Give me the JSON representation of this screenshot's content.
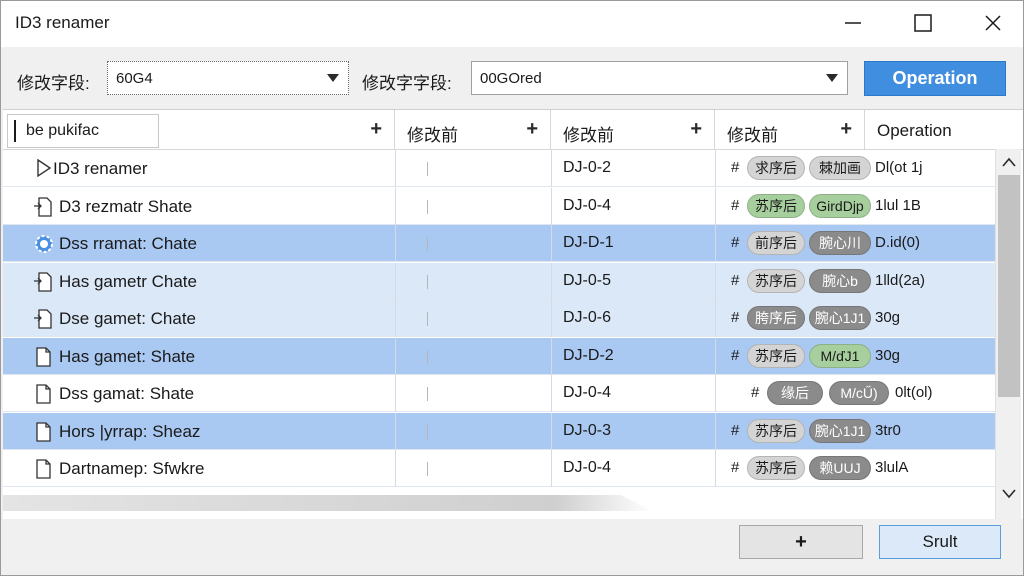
{
  "window": {
    "title": "ID3 renamer"
  },
  "toolbar": {
    "field1_label": "修改字段:",
    "field1_value": "60G4",
    "field2_label": "修改字字段:",
    "field2_value": "00GOred",
    "operation_label": "Operation"
  },
  "table": {
    "columns": [
      {
        "label": "be pukifac"
      },
      {
        "label": "修改前"
      },
      {
        "label": "修改前"
      },
      {
        "label": "修改前"
      },
      {
        "label": "Operation"
      }
    ],
    "rows": [
      {
        "name": "ID3 renamer",
        "code": "DJ-0-2",
        "tag1": "求序后",
        "tag2": "棘加画",
        "value": "Dl(ot 1j",
        "icon": "play-icon",
        "style": "plain",
        "tag1_color": "grey",
        "tag2_color": "grey"
      },
      {
        "name": "D3 rezmatr Shate",
        "code": "DJ-0-4",
        "tag1": "苏序后",
        "tag2": "GirdDjp",
        "value": "1lul 1B",
        "icon": "file-link-icon",
        "style": "plain",
        "tag1_color": "green",
        "tag2_color": "green"
      },
      {
        "name": "Dss rramat: Chate",
        "code": "DJ-D-1",
        "tag1": "前序后",
        "tag2": "腕心川",
        "value": "D.id(0)",
        "icon": "gear-icon",
        "style": "sel-strong",
        "tag1_color": "grey",
        "tag2_color": "dark"
      },
      {
        "name": "Has gametr Chate",
        "code": "DJ-0-5",
        "tag1": "苏序后",
        "tag2": "腕心b",
        "value": "1lld(2a)",
        "icon": "file-link-icon",
        "style": "sel-light",
        "tag1_color": "grey",
        "tag2_color": "dark"
      },
      {
        "name": "Dse gamet: Chate",
        "code": "DJ-0-6",
        "tag1": "胯序后",
        "tag2": "腕心1J1",
        "value": "30g",
        "icon": "file-link-icon",
        "style": "sel-light",
        "tag1_color": "dark",
        "tag2_color": "dark"
      },
      {
        "name": "Has gamet: Shate",
        "code": "DJ-D-2",
        "tag1": "苏序后",
        "tag2": "M/ďJ1",
        "value": "30g",
        "icon": "file-icon",
        "style": "sel-strong",
        "tag1_color": "grey",
        "tag2_color": "green"
      },
      {
        "name": "Dss gamat: Shate",
        "code": "DJ-0-4",
        "tag1": "缘后",
        "tag2": "M/cŰ)",
        "value": "0lt(ol)",
        "icon": "file-icon",
        "style": "plain",
        "tag1_color": "dark",
        "tag2_color": "dark"
      },
      {
        "name": "Hors |yrrap: Sheaz",
        "code": "DJ-0-3",
        "tag1": "苏序后",
        "tag2": "腕心1J1",
        "value": "3tr0",
        "icon": "file-icon",
        "style": "sel-strong",
        "tag1_color": "grey",
        "tag2_color": "dark"
      },
      {
        "name": "Dartnamep: Sfwkre",
        "code": "DJ-0-4",
        "tag1": "苏序后",
        "tag2": "赖UUJ",
        "value": "3lulA",
        "icon": "file-icon",
        "style": "plain",
        "tag1_color": "grey",
        "tag2_color": "dark"
      }
    ]
  },
  "footer": {
    "add_label": "+",
    "result_label": "Srult"
  },
  "colors": {
    "accent": "#3f8ee0",
    "selection_strong": "#a9c8f2",
    "selection_light": "#dbe8f8",
    "tag_green": "#a7cf9e",
    "tag_dark": "#8b8b8b"
  }
}
